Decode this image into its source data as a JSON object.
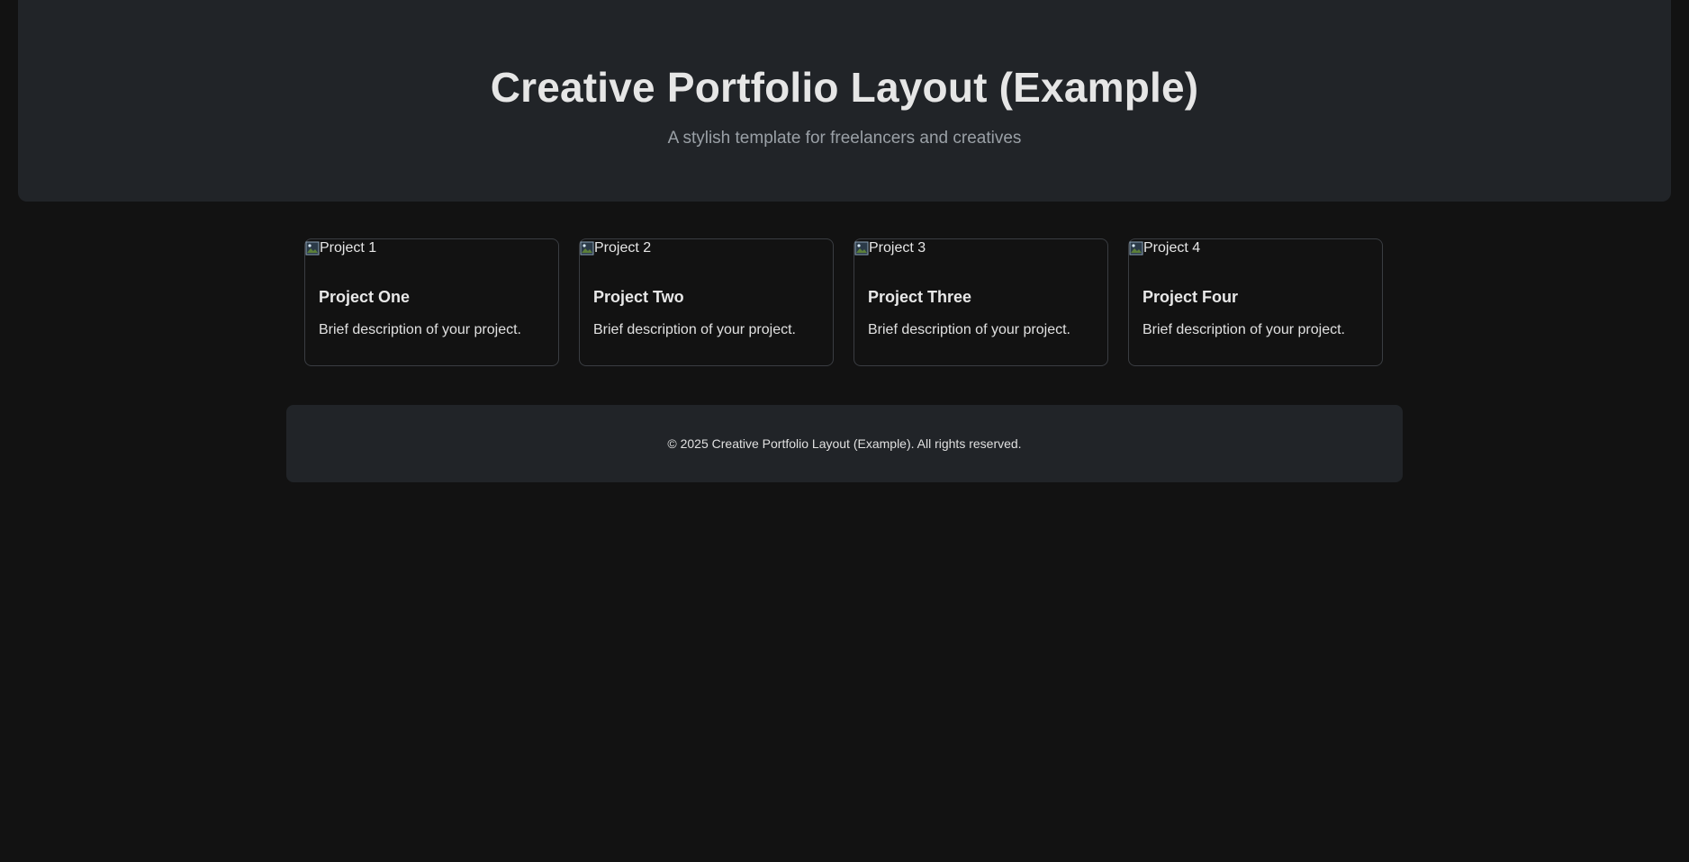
{
  "header": {
    "title": "Creative Portfolio Layout (Example)",
    "subtitle": "A stylish template for freelancers and creatives"
  },
  "projects": [
    {
      "image_alt": "Project 1",
      "title": "Project One",
      "description": "Brief description of your project."
    },
    {
      "image_alt": "Project 2",
      "title": "Project Two",
      "description": "Brief description of your project."
    },
    {
      "image_alt": "Project 3",
      "title": "Project Three",
      "description": "Brief description of your project."
    },
    {
      "image_alt": "Project 4",
      "title": "Project Four",
      "description": "Brief description of your project."
    }
  ],
  "footer": {
    "text": "© 2025 Creative Portfolio Layout (Example). All rights reserved."
  },
  "colors": {
    "background": "#121212",
    "panel": "#212428",
    "card_border": "#3a3d42",
    "title_text": "#e6e6e6",
    "muted_text": "#9aa0a6"
  },
  "icons": {
    "card_image": "broken-image-icon"
  }
}
